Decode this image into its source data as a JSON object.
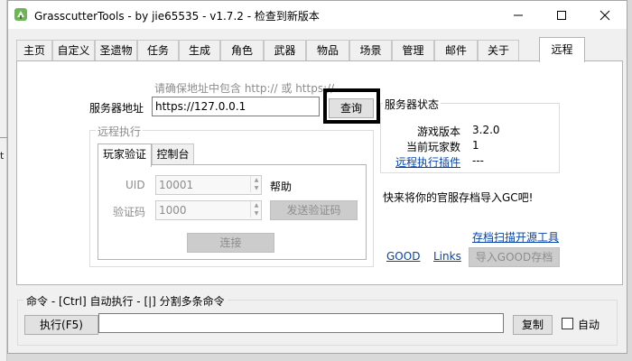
{
  "window": {
    "title": "GrasscutterTools  - by jie65535  - v1.7.2 - 检查到新版本",
    "controls": [
      "minimize-icon",
      "maximize-icon",
      "close-icon"
    ]
  },
  "background": {
    "edge_text": "t"
  },
  "tabs": [
    "主页",
    "自定义",
    "圣遗物",
    "任务",
    "生成",
    "角色",
    "武器",
    "物品",
    "场景",
    "管理",
    "邮件",
    "关于",
    "远程"
  ],
  "active_tab": "远程",
  "remote": {
    "hint": "请确保地址中包含 http:// 或 https://",
    "server_label": "服务器地址",
    "server_value": "https://127.0.0.1",
    "query_button": "查询",
    "remote_group_label": "远程执行",
    "subtabs": [
      "玩家验证",
      "控制台"
    ],
    "active_subtab": "玩家验证",
    "uid_label": "UID",
    "uid_value": "10001",
    "help_label": "帮助",
    "code_label": "验证码",
    "code_value": "1000",
    "send_code_button": "发送验证码",
    "connect_button": "连接"
  },
  "server_status": {
    "title": "服务器状态",
    "game_version_label": "游戏版本",
    "game_version_value": "3.2.0",
    "players_label": "当前玩家数",
    "players_value": "1",
    "plugin_link": "远程执行插件",
    "plugin_value": "---"
  },
  "import": {
    "prompt": "快来将你的官服存档导入GC吧!",
    "scan_link": "存档扫描开源工具",
    "good_link": "GOOD",
    "links_link": "Links",
    "import_button": "导入GOOD存档"
  },
  "command": {
    "legend": "命令  - [Ctrl] 自动执行  - [|] 分割多条命令",
    "execute_button": "执行(F5)",
    "input_value": "",
    "copy_button": "复制",
    "auto_label": "自动",
    "auto_checked": false
  },
  "colors": {
    "link": "#0645ad",
    "disabled_text": "#8c8c8c",
    "highlight_border": "#000000"
  }
}
